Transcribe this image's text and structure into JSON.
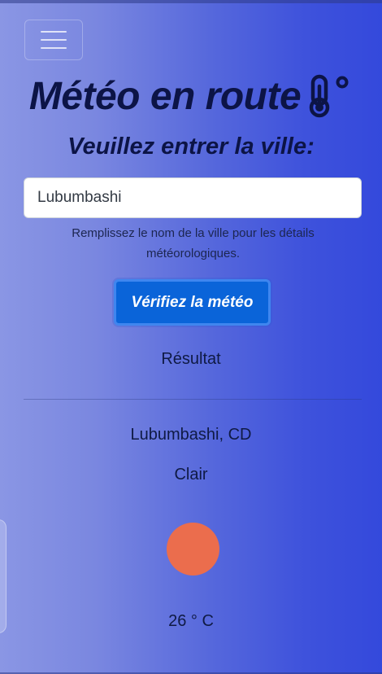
{
  "header": {
    "menu_icon": "hamburger-menu-icon",
    "title": "Météo en route",
    "title_icon": "thermometer-icon"
  },
  "form": {
    "prompt": "Veuillez entrer la ville:",
    "city_value": "Lubumbashi",
    "helper_text": "Remplissez le nom de la ville pour les détails météorologiques.",
    "submit_label": "Vérifiez la météo"
  },
  "result": {
    "heading": "Résultat",
    "location": "Lubumbashi, CD",
    "condition": "Clair",
    "condition_icon": "sun-icon",
    "temperature": "26 ° C"
  },
  "colors": {
    "accent_button": "#0a64d9",
    "sun": "#eb6d4d",
    "title_text": "#0c1446"
  }
}
